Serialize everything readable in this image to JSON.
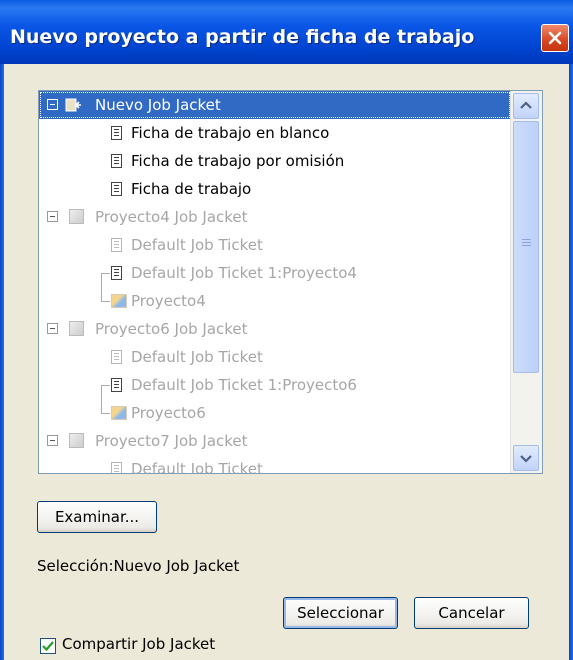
{
  "window": {
    "title": "Nuevo proyecto a partir de ficha de trabajo",
    "close_icon": "close-icon"
  },
  "tree": {
    "items": [
      {
        "label": "Nuevo Job Jacket",
        "kind": "jacket",
        "state": "selected"
      },
      {
        "label": "Ficha de trabajo en blanco",
        "kind": "ticket",
        "state": "normal"
      },
      {
        "label": "Ficha de trabajo por omisión",
        "kind": "ticket",
        "state": "normal"
      },
      {
        "label": "Ficha de trabajo",
        "kind": "ticket",
        "state": "normal"
      },
      {
        "label": "Proyecto4 Job Jacket",
        "kind": "jacket",
        "state": "disabled"
      },
      {
        "label": "Default Job Ticket",
        "kind": "ticket",
        "state": "disabled"
      },
      {
        "label": "Default Job Ticket 1:Proyecto4",
        "kind": "ticket",
        "state": "disabled"
      },
      {
        "label": "Proyecto4",
        "kind": "project",
        "state": "disabled"
      },
      {
        "label": "Proyecto6 Job Jacket",
        "kind": "jacket",
        "state": "disabled"
      },
      {
        "label": "Default Job Ticket",
        "kind": "ticket",
        "state": "disabled"
      },
      {
        "label": "Default Job Ticket 1:Proyecto6",
        "kind": "ticket",
        "state": "disabled"
      },
      {
        "label": "Proyecto6",
        "kind": "project",
        "state": "disabled"
      },
      {
        "label": "Proyecto7 Job Jacket",
        "kind": "jacket",
        "state": "disabled"
      },
      {
        "label": "Default Job Ticket",
        "kind": "ticket",
        "state": "disabled"
      }
    ]
  },
  "buttons": {
    "browse": "Examinar...",
    "select": "Seleccionar",
    "cancel": "Cancelar"
  },
  "selection": {
    "text": "Selección:Nuevo Job Jacket"
  },
  "share": {
    "label": "Compartir Job Jacket",
    "checked": true
  },
  "colors": {
    "titlebar": "#0a56e6",
    "selection": "#316ac5",
    "window_bg": "#ece9d8"
  }
}
